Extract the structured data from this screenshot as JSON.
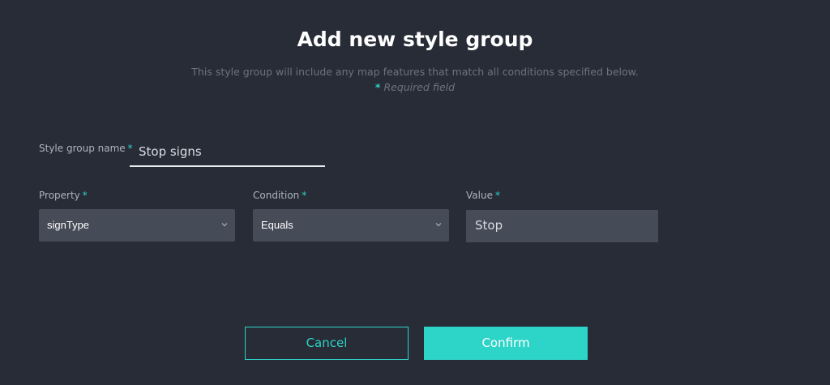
{
  "dialog": {
    "title": "Add new style group",
    "subtitle": "This style group will include any map features that match all conditions specified below.",
    "required_star": "*",
    "required_text": "Required field"
  },
  "form": {
    "name_label": "Style group name",
    "name_value": "Stop signs",
    "property_label": "Property",
    "property_value": "signType",
    "condition_label": "Condition",
    "condition_value": "Equals",
    "value_label": "Value",
    "value_value": "Stop",
    "required_mark": "*"
  },
  "buttons": {
    "cancel": "Cancel",
    "confirm": "Confirm"
  },
  "colors": {
    "background": "#272c37",
    "accent": "#2dd4c8",
    "field_bg": "#454b57"
  },
  "icons": {
    "select_chevron": "chevron-down-icon"
  }
}
